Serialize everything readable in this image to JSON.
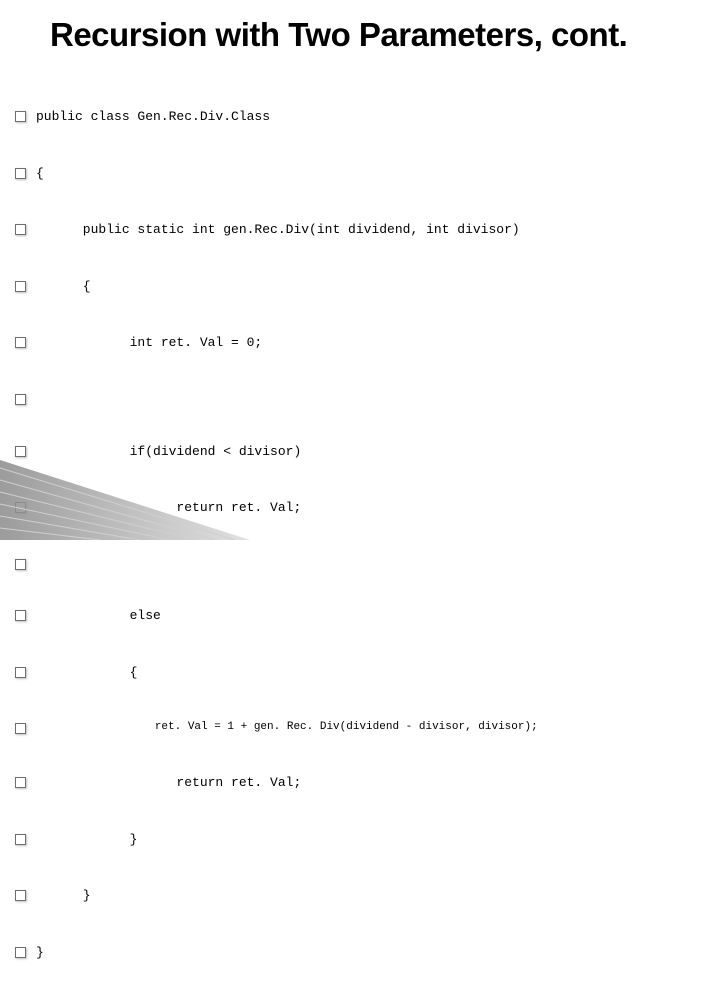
{
  "title": "Recursion with Two Parameters, cont.",
  "code": {
    "l0": "public class Gen.Rec.Div.Class",
    "l1": "{",
    "l2": "      public static int gen.Rec.Div(int dividend, int divisor)",
    "l3": "      {",
    "l4": "            int ret. Val = 0;",
    "l5": "",
    "l6": "            if(dividend < divisor)",
    "l7": "                  return ret. Val;",
    "l8": "",
    "l9": "            else",
    "l10": "            {",
    "l11": "                  ret. Val = 1 + gen. Rec. Div(dividend - divisor, divisor);",
    "l12": "                  return ret. Val;",
    "l13": "            }",
    "l14": "      }",
    "l15": "}"
  }
}
